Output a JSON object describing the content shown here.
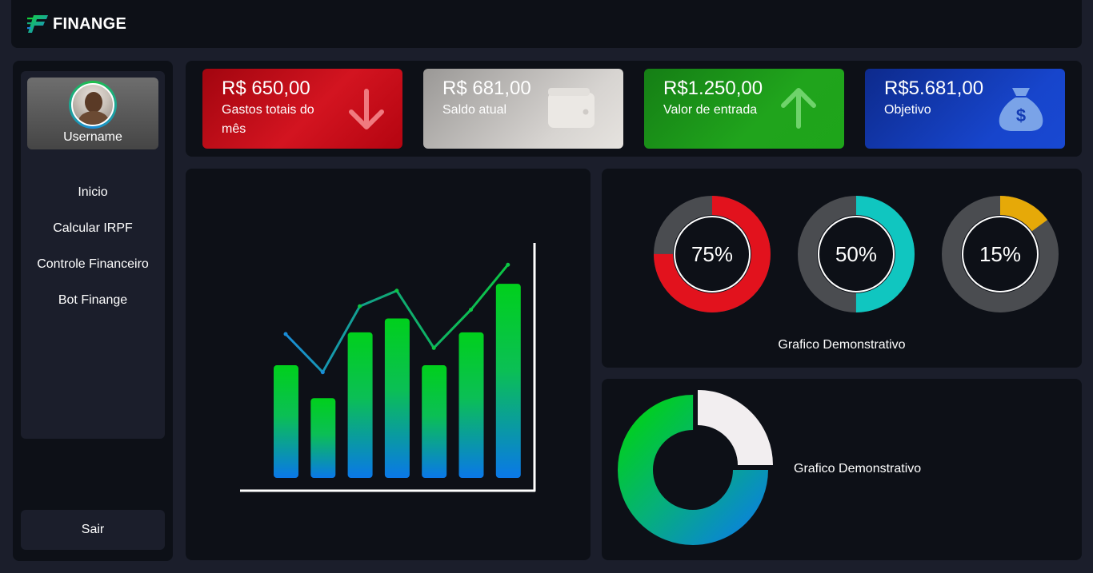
{
  "app": {
    "logo_text": "FINANGE"
  },
  "colors": {
    "background": "#1b1e2b",
    "panel": "#0d1017",
    "accent_green": "#00d01c",
    "accent_blue": "#0a78e8"
  },
  "user": {
    "name": "Username"
  },
  "sidebar": {
    "items": [
      {
        "label": "Inicio"
      },
      {
        "label": "Calcular IRPF"
      },
      {
        "label": "Controle Financeiro"
      },
      {
        "label": "Bot Finange"
      }
    ],
    "logout_label": "Sair"
  },
  "cards": [
    {
      "amount": "R$ 650,00",
      "label": "Gastos totais do mês",
      "icon": "arrow-down-icon",
      "color": "#c40b17"
    },
    {
      "amount": "R$ 681,00",
      "label": "Saldo atual",
      "icon": "wallet-icon",
      "color": "#bdbab7"
    },
    {
      "amount": "R$1.250,00",
      "label": "Valor de entrada",
      "icon": "arrow-up-icon",
      "color": "#1b9a18"
    },
    {
      "amount": "R$5.681,00",
      "label": "Objetivo",
      "icon": "money-bag-icon",
      "color": "#133bb4"
    }
  ],
  "gauges": {
    "caption": "Grafico Demonstrativo",
    "items": [
      {
        "label": "75%",
        "value": 0.75,
        "color": "#e2121d"
      },
      {
        "label": "50%",
        "value": 0.5,
        "color": "#10c6c0"
      },
      {
        "label": "15%",
        "value": 0.15,
        "color": "#e6a908"
      }
    ]
  },
  "donut": {
    "caption": "Grafico Demonstrativo",
    "light_share": 0.25
  },
  "chart_data": {
    "type": "bar",
    "bar_values": [
      6.5,
      4.6,
      8.4,
      9.2,
      6.5,
      8.4,
      11.2
    ],
    "line_values": [
      8.3,
      6.1,
      9.9,
      10.8,
      7.5,
      9.7,
      12.3
    ],
    "ylim": [
      0,
      16
    ],
    "grid": false,
    "title": "",
    "xlabel": "",
    "ylabel": ""
  }
}
